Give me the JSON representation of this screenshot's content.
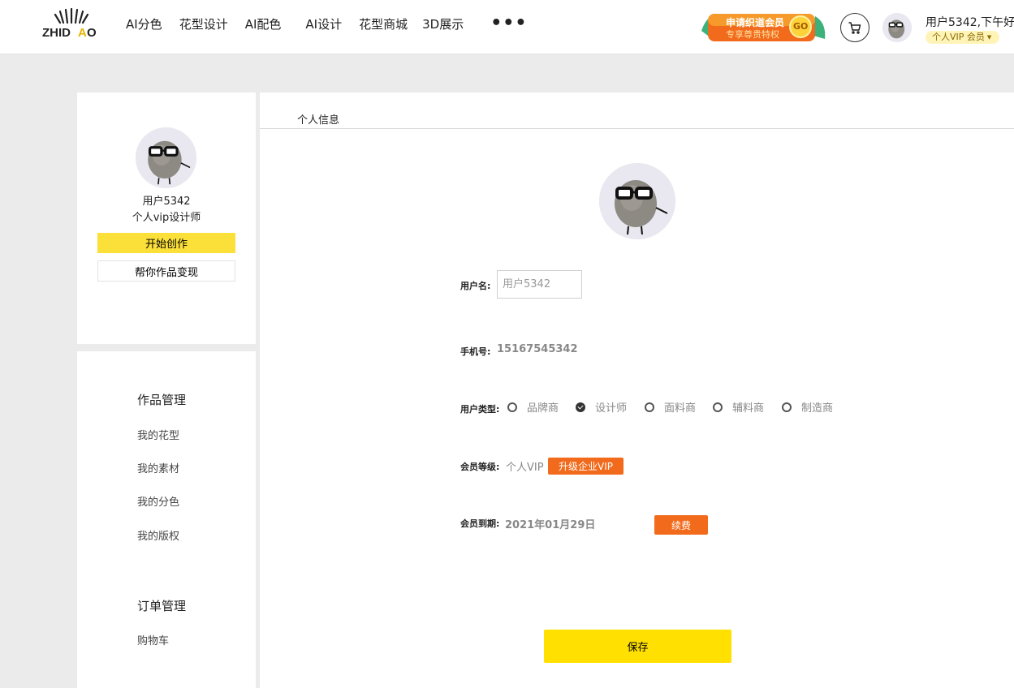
{
  "header": {
    "logo_text": "ZHIDAO",
    "nav": [
      "AI分色",
      "花型设计",
      "AI配色",
      "AI设计",
      "花型商城",
      "3D展示"
    ],
    "more_label": "•••",
    "vip_banner": {
      "line1": "申请织道会员",
      "line2": "专享尊贵特权",
      "go": "GO"
    },
    "username": "用户5342,下午好",
    "member_badge": "个人VIP 会员",
    "colors": {
      "accent_yellow": "#fce03a",
      "banner_orange": "#f26a1b",
      "banner_green": "#3cb179"
    }
  },
  "sidebar": {
    "username": "用户5342",
    "role": "个人vip设计师",
    "start_button": "开始创作",
    "monetize_button": "帮你作品变现",
    "groups": [
      {
        "title": "作品管理",
        "items": [
          "我的花型",
          "我的素材",
          "我的分色",
          "我的版权"
        ]
      },
      {
        "title": "订单管理",
        "items": [
          "购物车"
        ]
      }
    ]
  },
  "main": {
    "tab": "个人信息",
    "username_label": "用户名:",
    "username_placeholder": "用户5342",
    "phone_label": "手机号:",
    "phone_value": "15167545342",
    "type_label": "用户类型:",
    "types": [
      "品牌商",
      "设计师",
      "面料商",
      "辅料商",
      "制造商"
    ],
    "selected_type": "设计师",
    "level_label": "会员等级:",
    "level_value": "个人VIP",
    "upgrade_button": "升级企业VIP",
    "expiry_label": "会员到期:",
    "expiry_value": "2021年01月29日",
    "renew_button": "续费",
    "save_button": "保存"
  }
}
